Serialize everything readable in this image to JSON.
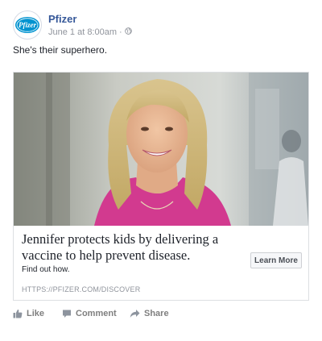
{
  "post": {
    "page_name": "Pfizer",
    "avatar_text": "Pfizer",
    "timestamp": "June 1 at 8:00am",
    "separator": "·",
    "privacy_icon": "globe-icon",
    "caption": "She's their superhero."
  },
  "ad": {
    "image_icon": "photo-woman-smiling",
    "headline": "Jennifer protects kids by delivering a vaccine to help prevent disease.",
    "description": "Find out how.",
    "cta_label": "Learn More",
    "display_url": "HTTPS://PFIZER.COM/DISCOVER"
  },
  "actions": {
    "like_label": "Like",
    "comment_label": "Comment",
    "share_label": "Share"
  },
  "colors": {
    "brand_blue": "#365899",
    "pfizer_blue": "#0093d0",
    "meta_gray": "#90949c",
    "action_gray": "#7f7f7f"
  }
}
